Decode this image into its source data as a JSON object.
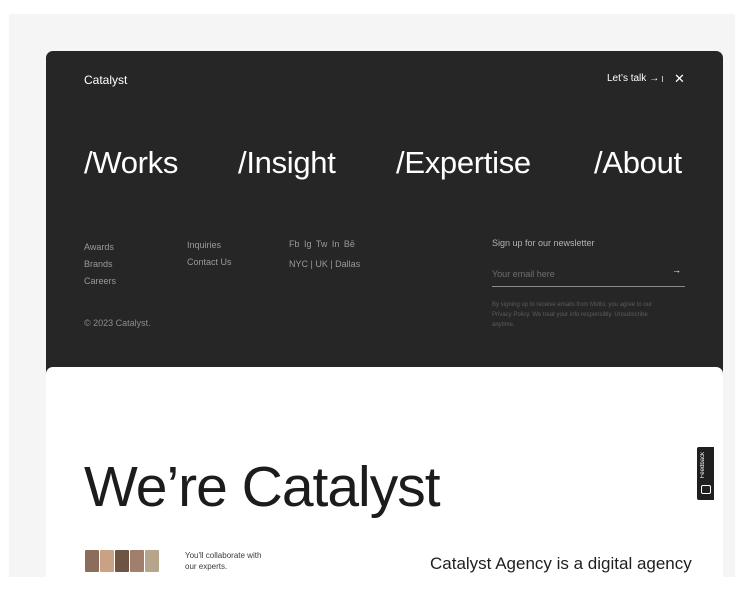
{
  "header": {
    "brand": "Catalyst",
    "talk_label": "Let’s talk",
    "talk_arrow": "→",
    "close_glyph": "✕"
  },
  "nav": [
    {
      "label": "/Works"
    },
    {
      "label": "/Insight"
    },
    {
      "label": "/Expertise"
    },
    {
      "label": "/About"
    }
  ],
  "links_col1": [
    "Awards",
    "Brands",
    "Careers"
  ],
  "links_col2": [
    "Inquiries",
    "Contact Us"
  ],
  "social": "Fb  Ig  Tw  In  Bē",
  "cities": "NYC | UK | Dallas",
  "copyright": "© 2023 Catalyst.",
  "newsletter": {
    "title": "Sign up for our newsletter",
    "placeholder": "Your email here",
    "submit_arrow": "→",
    "legal": "By signing up to receive emails from Motto, you agree to our Privacy Policy. We treat your info responsibly. Unsubscribe anytime."
  },
  "hero": {
    "title": "We’re Catalyst"
  },
  "team": {
    "caption": "You'll collaborate with our experts.",
    "avatar_colors": [
      "#8a6d5a",
      "#c9a184",
      "#6e5443",
      "#a0806c",
      "#b6a58a"
    ]
  },
  "about_text": "Catalyst Agency is a digital agency",
  "feedback": {
    "label": "Feedback"
  }
}
